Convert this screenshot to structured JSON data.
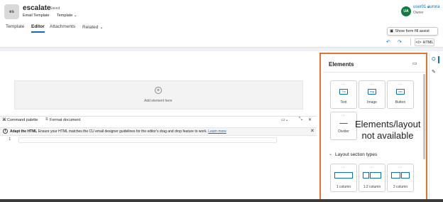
{
  "header": {
    "avatar_initials": "es",
    "title": "escalate",
    "save_status": "- Saved",
    "entity": "Email Template",
    "form_name": "Template",
    "user_initials": "UA",
    "user_name": "user01 aurora",
    "user_role": "Owner"
  },
  "tabs": [
    {
      "label": "Template"
    },
    {
      "label": "Editor"
    },
    {
      "label": "Attachments"
    },
    {
      "label": "Related"
    }
  ],
  "toolbar": {
    "form_fill_assist": "Show form fill assist",
    "html_label": "HTML"
  },
  "editor": {
    "add_element": "Add element here",
    "command_palette": "Command palette",
    "format_document": "Format document",
    "info_bold": "Adapt the HTML",
    "info_text": "Ensure your HTML matches the CU email designer guidelines for the editor's drag and drop feature to work.",
    "info_link": "Learn more",
    "line_number": "1"
  },
  "panel": {
    "title": "Elements",
    "elements": [
      {
        "label": "Text",
        "glyph": "Txt"
      },
      {
        "label": "Image",
        "glyph": "img"
      },
      {
        "label": "Button",
        "glyph": "btn"
      },
      {
        "label": "Divider",
        "glyph": "—"
      }
    ],
    "overlay_note": "Elements/layout not available",
    "layout_header": "Layout section types",
    "layouts": [
      {
        "label": "1 column"
      },
      {
        "label": "1:2 column"
      },
      {
        "label": "2 column"
      }
    ]
  },
  "colors": {
    "accent": "#0f6cbd",
    "highlight_border": "#e3742f",
    "user_avatar": "#107c41"
  }
}
